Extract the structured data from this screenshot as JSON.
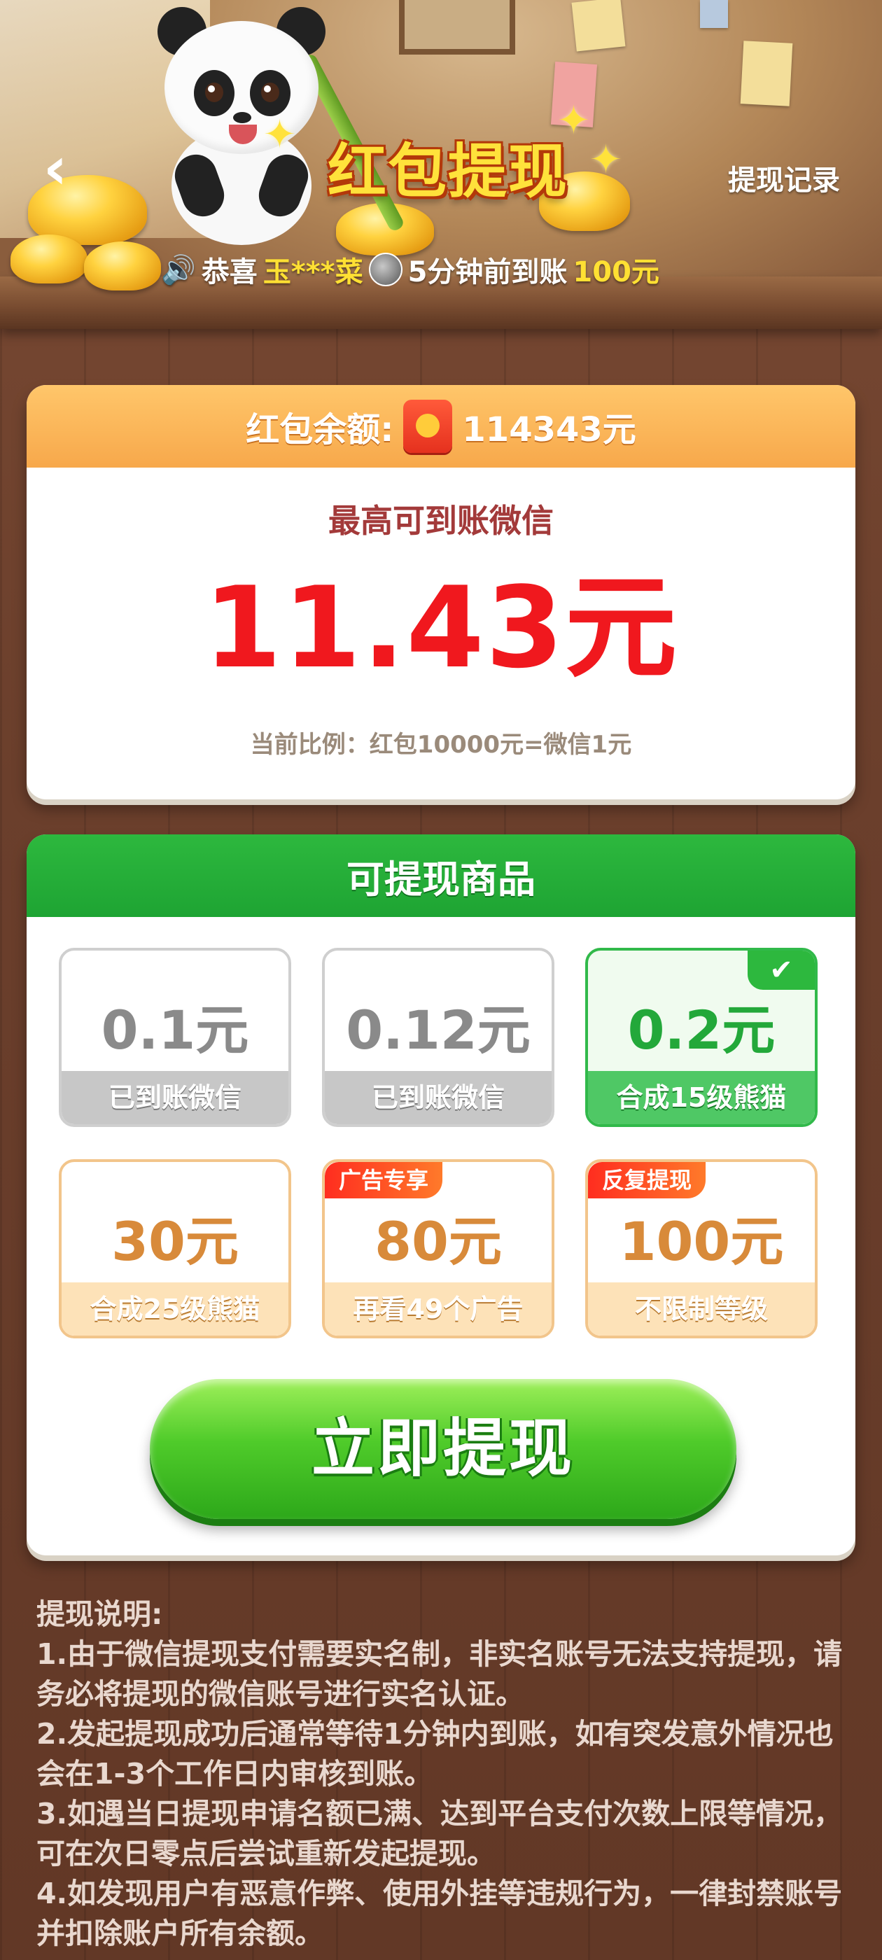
{
  "header": {
    "title": "红包提现",
    "history_label": "提现记录",
    "ticker": {
      "prefix": "恭喜",
      "user": "玉***菜",
      "message": "5分钟前到账",
      "amount": "100元"
    }
  },
  "balance": {
    "label": "红包余额:",
    "amount": "114343元",
    "max_label": "最高可到账微信",
    "max_amount": "11.43元",
    "ratio": "当前比例：红包10000元=微信1元"
  },
  "products": {
    "title": "可提现商品",
    "items": [
      {
        "amount": "0.1元",
        "status": "已到账微信",
        "state": "done"
      },
      {
        "amount": "0.12元",
        "status": "已到账微信",
        "state": "done"
      },
      {
        "amount": "0.2元",
        "status": "合成15级熊猫",
        "state": "selected"
      },
      {
        "amount": "30元",
        "status": "合成25级熊猫",
        "state": "locked"
      },
      {
        "amount": "80元",
        "status": "再看49个广告",
        "state": "locked",
        "tag": "广告专享"
      },
      {
        "amount": "100元",
        "status": "不限制等级",
        "state": "locked",
        "tag": "反复提现"
      }
    ],
    "withdraw_label": "立即提现"
  },
  "instructions": {
    "title": "提现说明:",
    "lines": [
      "1.由于微信提现支付需要实名制，非实名账号无法支持提现，请务必将提现的微信账号进行实名认证。",
      "2.发起提现成功后通常等待1分钟内到账，如有突发意外情况也会在1-3个工作日内审核到账。",
      "3.如遇当日提现申请名额已满、达到平台支付次数上限等情况，可在次日零点后尝试重新发起提现。",
      "4.如发现用户有恶意作弊、使用外挂等违规行为，一律封禁账号并扣除账户所有余额。"
    ]
  },
  "icons": {
    "back": "back-arrow-icon",
    "speaker": "speaker-icon",
    "check": "check-icon",
    "redpacket": "red-packet-icon"
  },
  "colors": {
    "accent_green": "#2db83e",
    "accent_orange": "#f7a84b",
    "amount_red": "#f0181e",
    "title_yellow": "#ffe23b"
  }
}
